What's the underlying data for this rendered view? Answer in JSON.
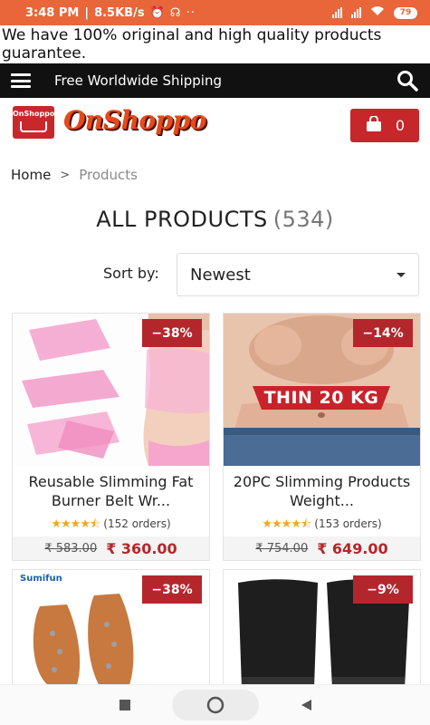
{
  "status_bar": {
    "time": "3:48 PM",
    "speed": "8.5KB/s",
    "battery": "79"
  },
  "announcement": "We have 100% original and high quality products guarantee.",
  "navbar": {
    "shipping_text": "Free Worldwide Shipping"
  },
  "header": {
    "logo_badge_text": "OnShoppo",
    "logo_text": "OnShoppo",
    "cart_count": "0"
  },
  "breadcrumb": {
    "home": "Home",
    "separator": ">",
    "current": "Products"
  },
  "heading": {
    "title": "ALL PRODUCTS",
    "count": "(534)"
  },
  "sort": {
    "label": "Sort by:",
    "selected": "Newest"
  },
  "products": [
    {
      "title": "Reusable Slimming Fat Burner Belt Wr...",
      "discount": "−38%",
      "rating": "★★★★⯪",
      "orders": "(152 orders)",
      "old_price": "₹ 583.00",
      "new_price": "₹ 360.00"
    },
    {
      "title": "20PC Slimming Products Weight...",
      "discount": "−14%",
      "rating": "★★★★⯪",
      "orders": "(153 orders)",
      "old_price": "₹ 754.00",
      "new_price": "₹ 649.00",
      "image_text": "THIN 20 KG"
    },
    {
      "discount": "−38%",
      "image_text": "Sumifun"
    },
    {
      "discount": "−9%"
    }
  ],
  "colors": {
    "status_bar": "#e8663a",
    "brand_red": "#b3272c",
    "navbar": "#111111",
    "star": "#f3a81b"
  }
}
